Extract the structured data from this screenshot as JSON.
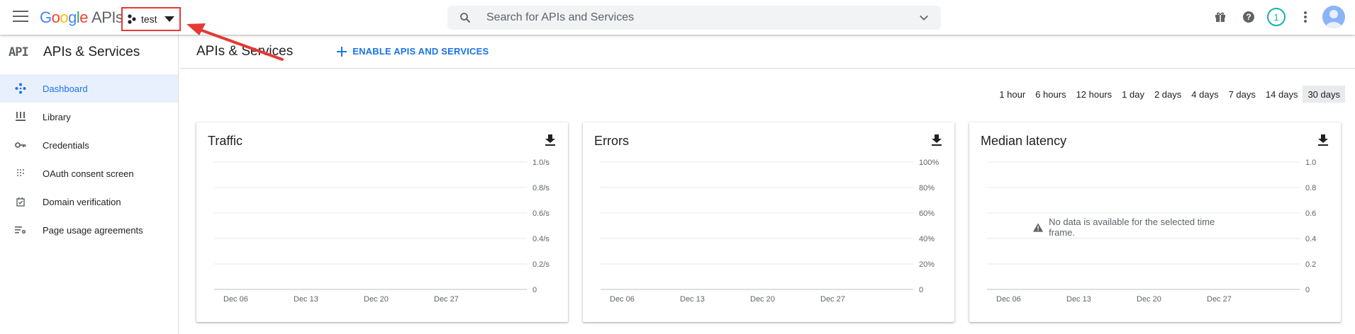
{
  "header": {
    "logo_google": "Google",
    "logo_apis": "APIs",
    "project_name": "test",
    "search_placeholder": "Search for APIs and Services",
    "notification_count": "1"
  },
  "sidebar": {
    "api_logo": "API",
    "title": "APIs & Services",
    "items": [
      {
        "label": "Dashboard",
        "icon": "dashboard-icon",
        "active": true
      },
      {
        "label": "Library",
        "icon": "library-icon",
        "active": false
      },
      {
        "label": "Credentials",
        "icon": "key-icon",
        "active": false
      },
      {
        "label": "OAuth consent screen",
        "icon": "oauth-icon",
        "active": false
      },
      {
        "label": "Domain verification",
        "icon": "domain-check-icon",
        "active": false
      },
      {
        "label": "Page usage agreements",
        "icon": "settings-list-icon",
        "active": false
      }
    ]
  },
  "main": {
    "title": "APIs & Services",
    "enable_button": "ENABLE APIS AND SERVICES",
    "time_ranges": [
      "1 hour",
      "6 hours",
      "12 hours",
      "1 day",
      "2 days",
      "4 days",
      "7 days",
      "14 days",
      "30 days"
    ],
    "selected_range": "30 days",
    "no_data_message": "No data is available for the selected time frame."
  },
  "colors": {
    "accent": "#1a73e8",
    "annotation": "#e53935",
    "teal": "#12b5a5"
  },
  "chart_data": [
    {
      "type": "line",
      "title": "Traffic",
      "x_ticks": [
        "Dec 06",
        "Dec 13",
        "Dec 20",
        "Dec 27"
      ],
      "y_ticks": [
        "1.0/s",
        "0.8/s",
        "0.6/s",
        "0.4/s",
        "0.2/s",
        "0"
      ],
      "ylim": [
        0,
        1.0
      ],
      "grid": true,
      "series": []
    },
    {
      "type": "line",
      "title": "Errors",
      "x_ticks": [
        "Dec 06",
        "Dec 13",
        "Dec 20",
        "Dec 27"
      ],
      "y_ticks": [
        "100%",
        "80%",
        "60%",
        "40%",
        "20%",
        "0"
      ],
      "ylim": [
        0,
        100
      ],
      "grid": true,
      "series": []
    },
    {
      "type": "line",
      "title": "Median latency",
      "x_ticks": [
        "Dec 06",
        "Dec 13",
        "Dec 20",
        "Dec 27"
      ],
      "y_ticks": [
        "1.0",
        "0.8",
        "0.6",
        "0.4",
        "0.2",
        "0"
      ],
      "ylim": [
        0,
        1.0
      ],
      "grid": true,
      "series": []
    }
  ]
}
